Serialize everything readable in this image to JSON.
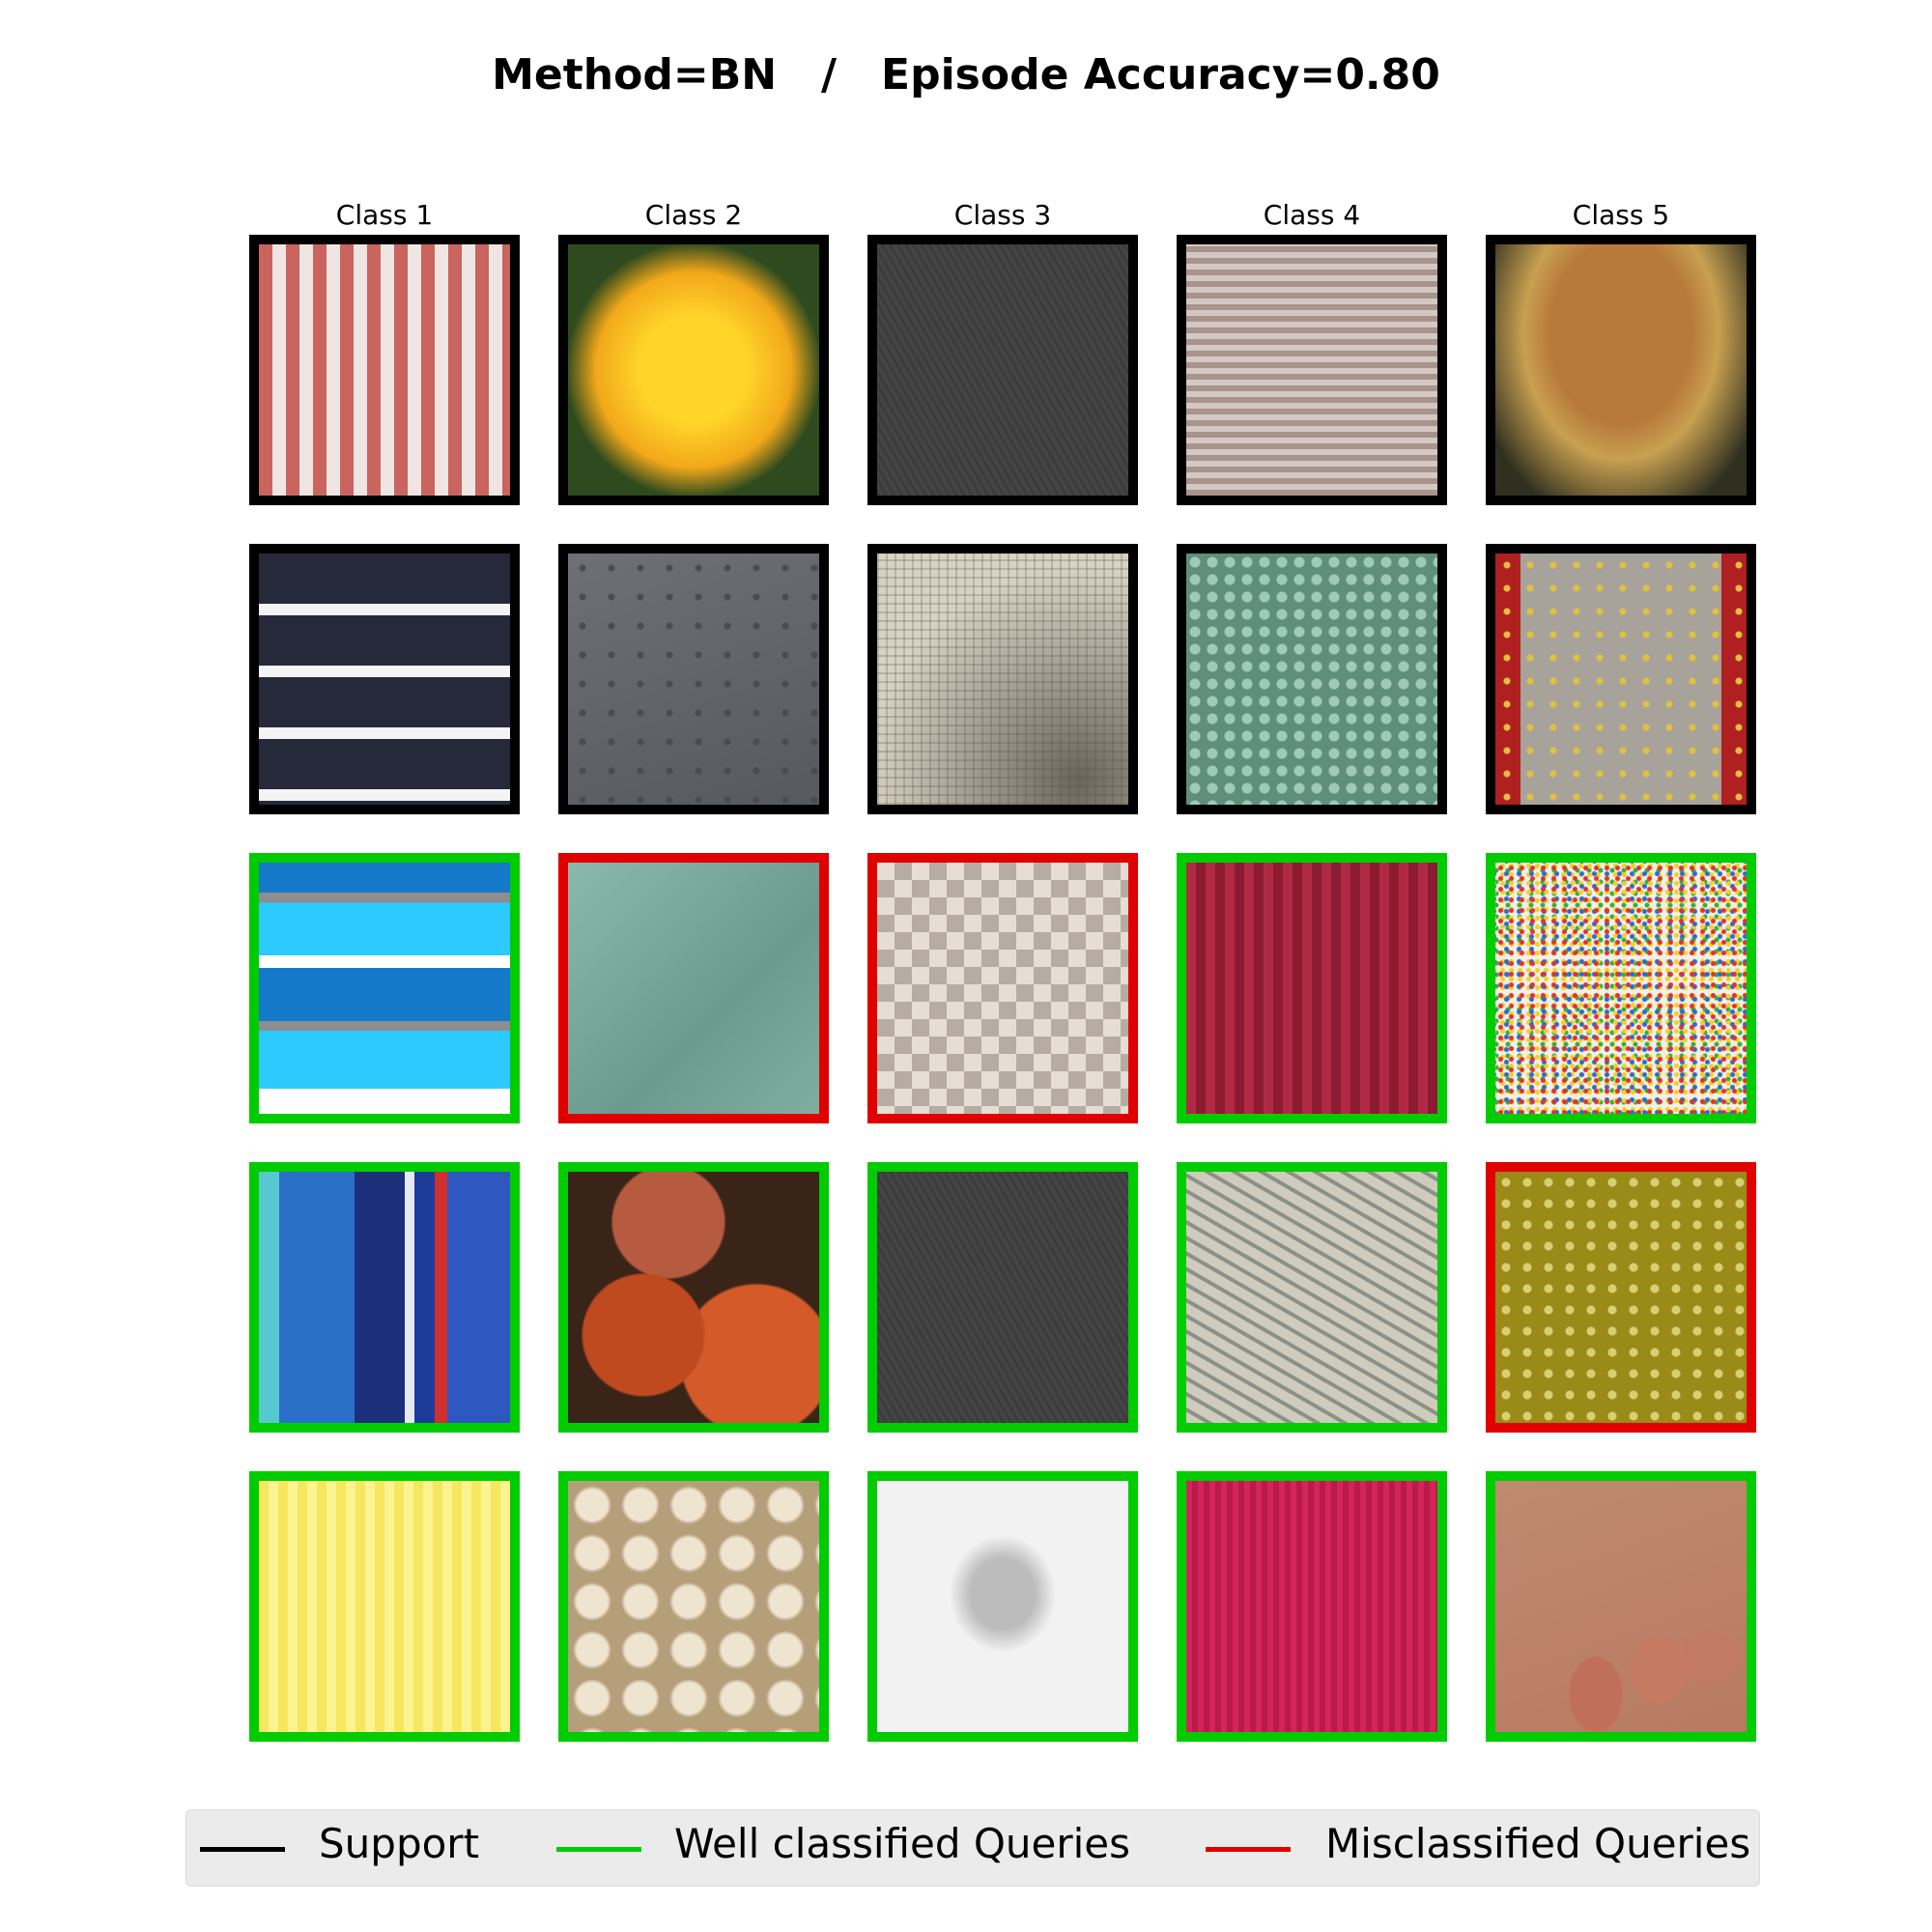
{
  "title": "Method=BN   /   Episode Accuracy=0.80",
  "columns": [
    "Class 1",
    "Class 2",
    "Class 3",
    "Class 4",
    "Class 5"
  ],
  "colors": {
    "support": "#000000",
    "well": "#00cc00",
    "mis": "#e00000"
  },
  "legend": {
    "support": "Support",
    "well": "Well classified Queries",
    "mis": "Misclassified Queries"
  },
  "grid": [
    [
      {
        "status": "support",
        "texture": "red-white-vertical-stripes"
      },
      {
        "status": "support",
        "texture": "warty-yellow-gourd"
      },
      {
        "status": "support",
        "texture": "dark-grey-scratched"
      },
      {
        "status": "support",
        "texture": "grey-woven-knit"
      },
      {
        "status": "support",
        "texture": "brown-crumbled-speckles"
      }
    ],
    [
      {
        "status": "support",
        "texture": "navy-white-horizontal-stripes"
      },
      {
        "status": "support",
        "texture": "grey-dotted-plastic"
      },
      {
        "status": "support",
        "texture": "beige-crosshatch-fabric"
      },
      {
        "status": "support",
        "texture": "green-knit"
      },
      {
        "status": "support",
        "texture": "leaves-on-path"
      }
    ],
    [
      {
        "status": "well",
        "texture": "blue-horizontal-stripes"
      },
      {
        "status": "mis",
        "texture": "teal-crumpled-paper"
      },
      {
        "status": "mis",
        "texture": "diamond-tiles"
      },
      {
        "status": "well",
        "texture": "red-knit"
      },
      {
        "status": "well",
        "texture": "rainbow-sprinkles"
      }
    ],
    [
      {
        "status": "well",
        "texture": "blue-vertical-stripes"
      },
      {
        "status": "well",
        "texture": "orange-warty-pumpkins"
      },
      {
        "status": "well",
        "texture": "dark-grey-scratched"
      },
      {
        "status": "well",
        "texture": "white-rope-weave"
      },
      {
        "status": "mis",
        "texture": "olive-yellow-speckles"
      }
    ],
    [
      {
        "status": "well",
        "texture": "yellow-vertical-stripes"
      },
      {
        "status": "well",
        "texture": "white-gourds"
      },
      {
        "status": "well",
        "texture": "pencil-sketch-face"
      },
      {
        "status": "well",
        "texture": "pink-knit"
      },
      {
        "status": "well",
        "texture": "glitter-toes"
      }
    ]
  ]
}
